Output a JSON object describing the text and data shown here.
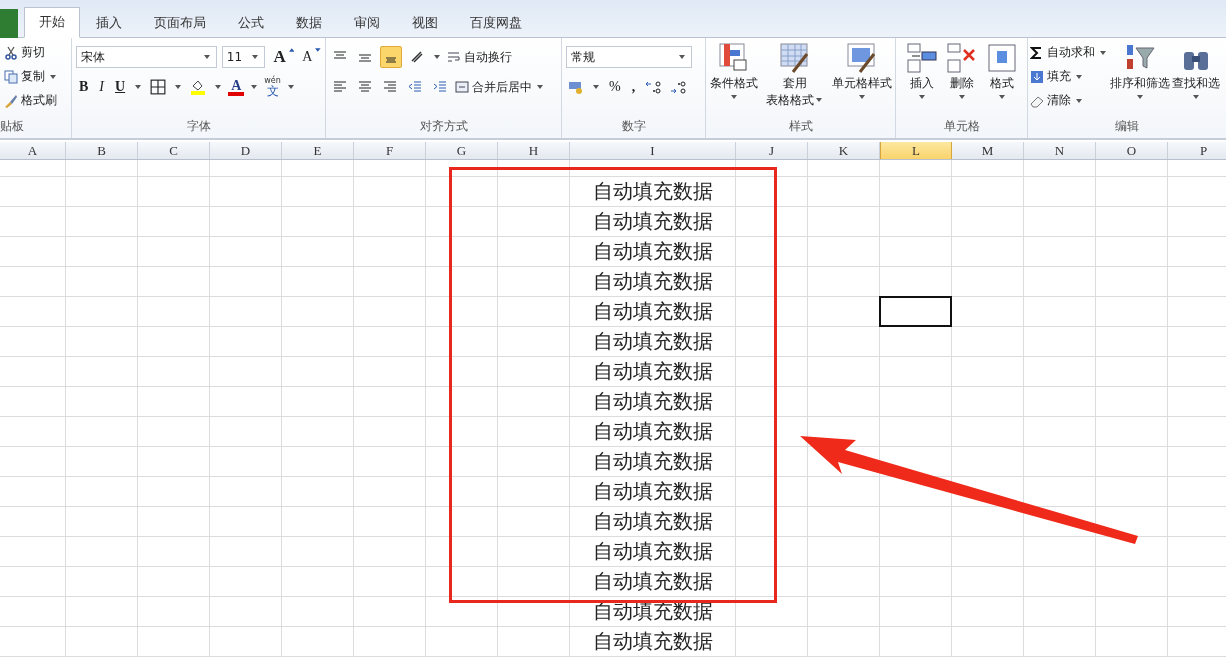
{
  "tabs": [
    {
      "label": "开始",
      "selected": true
    },
    {
      "label": "插入",
      "selected": false
    },
    {
      "label": "页面布局",
      "selected": false
    },
    {
      "label": "公式",
      "selected": false
    },
    {
      "label": "数据",
      "selected": false
    },
    {
      "label": "审阅",
      "selected": false
    },
    {
      "label": "视图",
      "selected": false
    },
    {
      "label": "百度网盘",
      "selected": false
    }
  ],
  "clipboard": {
    "label": "贴板",
    "cut": "剪切",
    "copy": "复制",
    "format_painter": "格式刷"
  },
  "font": {
    "label": "字体",
    "font_name": "宋体",
    "font_size": "11",
    "grow": "A",
    "shrink": "A",
    "bold": "B",
    "italic": "I",
    "underline": "U",
    "font_color": "A",
    "phonetic_top": "wén",
    "phonetic": "文"
  },
  "alignment": {
    "label": "对齐方式",
    "wrap_text": "自动换行",
    "merge_center": "合并后居中",
    "bottom_align_selected": true
  },
  "number": {
    "label": "数字",
    "format": "常规",
    "percent": "%",
    "comma": ","
  },
  "styles": {
    "label": "样式",
    "conditional": "条件格式",
    "table_line1": "套用",
    "table_line2": "表格格式",
    "cell_styles": "单元格样式"
  },
  "cells": {
    "label": "单元格",
    "insert": "插入",
    "delete": "删除",
    "format": "格式"
  },
  "editing": {
    "label": "编辑",
    "autosum": "自动求和",
    "fill": "填充",
    "clear": "清除",
    "sort_filter": "排序和筛选",
    "find_select": "查找和选"
  },
  "columns": [
    {
      "label": "A",
      "selected": false
    },
    {
      "label": "B",
      "selected": false
    },
    {
      "label": "C",
      "selected": false
    },
    {
      "label": "D",
      "selected": false
    },
    {
      "label": "E",
      "selected": false
    },
    {
      "label": "F",
      "selected": false
    },
    {
      "label": "G",
      "selected": false
    },
    {
      "label": "H",
      "selected": false
    },
    {
      "label": "I",
      "selected": false
    },
    {
      "label": "J",
      "selected": false
    },
    {
      "label": "K",
      "selected": false
    },
    {
      "label": "L",
      "selected": true
    },
    {
      "label": "M",
      "selected": false
    },
    {
      "label": "N",
      "selected": false
    },
    {
      "label": "O",
      "selected": false
    },
    {
      "label": "P",
      "selected": false
    }
  ],
  "rows": [
    {
      "column_i": "自动填充数据",
      "selected": false
    },
    {
      "column_i": "自动填充数据",
      "selected": false
    },
    {
      "column_i": "自动填充数据",
      "selected": false
    },
    {
      "column_i": "自动填充数据",
      "selected": false
    },
    {
      "column_i": "自动填充数据",
      "selected": true
    },
    {
      "column_i": "自动填充数据",
      "selected": false
    },
    {
      "column_i": "自动填充数据",
      "selected": false
    },
    {
      "column_i": "自动填充数据",
      "selected": false
    },
    {
      "column_i": "自动填充数据",
      "selected": false
    },
    {
      "column_i": "自动填充数据",
      "selected": false
    },
    {
      "column_i": "自动填充数据",
      "selected": false
    },
    {
      "column_i": "自动填充数据",
      "selected": false
    },
    {
      "column_i": "自动填充数据",
      "selected": false
    },
    {
      "column_i": "自动填充数据",
      "selected": false
    },
    {
      "column_i": "自动填充数据",
      "selected": false
    },
    {
      "column_i": "自动填充数据",
      "selected": false
    }
  ]
}
